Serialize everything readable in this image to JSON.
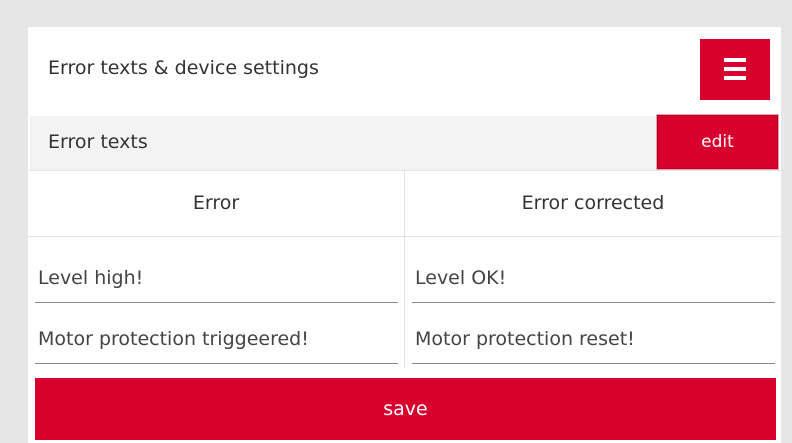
{
  "header": {
    "title": "Error texts & device settings",
    "menu_icon": "hamburger-menu-icon"
  },
  "section": {
    "title": "Error texts",
    "edit_label": "edit"
  },
  "table": {
    "columns": [
      "Error",
      "Error corrected"
    ],
    "rows": [
      {
        "error": "Level high!",
        "corrected": "Level OK!"
      },
      {
        "error": "Motor protection triggeered!",
        "corrected": "Motor protection reset!"
      }
    ]
  },
  "actions": {
    "save_label": "save"
  },
  "colors": {
    "accent": "#d8002d",
    "background": "#e6e6e6",
    "panel": "#ffffff",
    "section_bar": "#f3f3f3"
  }
}
